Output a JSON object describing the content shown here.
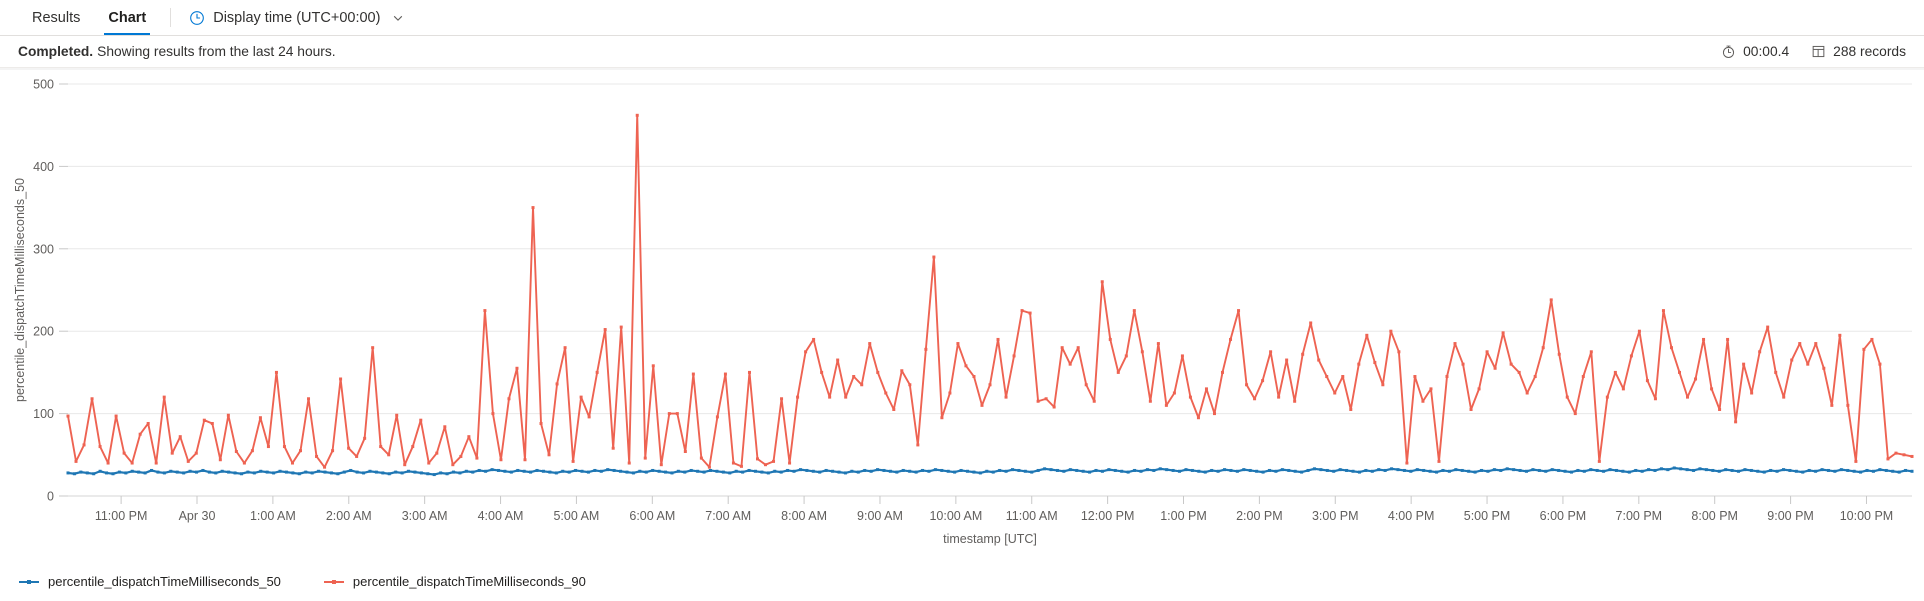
{
  "tabs": [
    {
      "label": "Results",
      "active": false,
      "name": "tab-results"
    },
    {
      "label": "Chart",
      "active": true,
      "name": "tab-chart"
    }
  ],
  "toolbar": {
    "display_time_label": "Display time (UTC+00:00)",
    "clock_icon": "clock-icon",
    "chevron_icon": "chevron-down-icon"
  },
  "status": {
    "state": "Completed.",
    "message": "Showing results from the last 24 hours.",
    "duration": "00:00.4",
    "duration_icon": "stopwatch-icon",
    "records": "288 records",
    "records_icon": "table-icon"
  },
  "colors": {
    "accent": "#0078d4",
    "series_50": "#1f77b4",
    "series_90": "#ee6352",
    "gridline": "#e8e8e8",
    "text": "#323130",
    "muted": "#605e5c"
  },
  "chart_data": {
    "type": "line",
    "title": "",
    "xlabel": "timestamp [UTC]",
    "ylabel": "percentile_dispatchTimeMilliseconds_50",
    "ylim": [
      0,
      500
    ],
    "yticks": [
      0,
      100,
      200,
      300,
      400,
      500
    ],
    "grid": true,
    "legend_position": "bottom-left",
    "xticks": [
      "11:00 PM",
      "Apr 30",
      "1:00 AM",
      "2:00 AM",
      "3:00 AM",
      "4:00 AM",
      "5:00 AM",
      "6:00 AM",
      "7:00 AM",
      "8:00 AM",
      "9:00 AM",
      "10:00 AM",
      "11:00 AM",
      "12:00 PM",
      "1:00 PM",
      "2:00 PM",
      "3:00 PM",
      "4:00 PM",
      "5:00 PM",
      "6:00 PM",
      "7:00 PM",
      "8:00 PM",
      "9:00 PM",
      "10:00 PM"
    ],
    "x_start_hours": 22.3,
    "x_end_hours": 46.6,
    "series": [
      {
        "name": "percentile_dispatchTimeMilliseconds_50",
        "color": "#1f77b4",
        "values": [
          28,
          27,
          29,
          28,
          27,
          30,
          28,
          27,
          29,
          28,
          30,
          29,
          28,
          31,
          29,
          28,
          30,
          29,
          28,
          30,
          29,
          31,
          29,
          28,
          30,
          29,
          28,
          27,
          29,
          28,
          30,
          29,
          28,
          30,
          29,
          28,
          27,
          29,
          28,
          30,
          29,
          28,
          27,
          29,
          31,
          29,
          28,
          30,
          29,
          28,
          27,
          29,
          28,
          30,
          29,
          28,
          27,
          26,
          28,
          27,
          29,
          28,
          30,
          29,
          31,
          30,
          32,
          31,
          30,
          29,
          31,
          30,
          29,
          31,
          30,
          29,
          28,
          30,
          29,
          31,
          30,
          29,
          31,
          30,
          32,
          31,
          30,
          29,
          28,
          30,
          29,
          31,
          30,
          29,
          28,
          30,
          29,
          31,
          30,
          29,
          31,
          30,
          29,
          28,
          30,
          29,
          31,
          30,
          29,
          28,
          30,
          29,
          31,
          30,
          32,
          31,
          30,
          29,
          31,
          30,
          29,
          28,
          30,
          29,
          31,
          30,
          32,
          31,
          30,
          29,
          31,
          30,
          29,
          31,
          30,
          32,
          31,
          30,
          29,
          31,
          30,
          29,
          28,
          30,
          29,
          31,
          30,
          32,
          31,
          30,
          29,
          31,
          33,
          32,
          31,
          30,
          32,
          31,
          30,
          29,
          31,
          30,
          32,
          31,
          30,
          29,
          31,
          30,
          32,
          31,
          33,
          32,
          31,
          30,
          32,
          31,
          30,
          29,
          31,
          30,
          32,
          31,
          30,
          32,
          31,
          30,
          29,
          31,
          30,
          32,
          31,
          30,
          29,
          31,
          33,
          32,
          31,
          30,
          32,
          31,
          30,
          29,
          31,
          30,
          32,
          31,
          33,
          32,
          31,
          30,
          32,
          31,
          30,
          29,
          31,
          30,
          32,
          31,
          30,
          29,
          31,
          30,
          32,
          31,
          33,
          32,
          31,
          30,
          32,
          31,
          30,
          32,
          31,
          30,
          29,
          31,
          30,
          32,
          31,
          30,
          32,
          31,
          30,
          29,
          31,
          30,
          32,
          31,
          33,
          32,
          34,
          33,
          32,
          31,
          33,
          32,
          31,
          30,
          32,
          31,
          30,
          32,
          31,
          30,
          29,
          31,
          30,
          32,
          31,
          30,
          29,
          31,
          30,
          32,
          31,
          30,
          32,
          31,
          30,
          29,
          31,
          30,
          32,
          31,
          30,
          29,
          31,
          30
        ]
      },
      {
        "name": "percentile_dispatchTimeMilliseconds_90",
        "color": "#ee6352",
        "values": [
          97,
          42,
          62,
          118,
          60,
          40,
          97,
          52,
          40,
          75,
          88,
          40,
          120,
          52,
          72,
          42,
          52,
          92,
          88,
          44,
          98,
          54,
          40,
          55,
          95,
          60,
          150,
          60,
          40,
          55,
          118,
          48,
          35,
          55,
          142,
          58,
          48,
          70,
          180,
          60,
          50,
          98,
          38,
          60,
          92,
          40,
          52,
          84,
          38,
          48,
          72,
          46,
          225,
          100,
          44,
          118,
          155,
          44,
          350,
          88,
          50,
          136,
          180,
          42,
          120,
          96,
          150,
          202,
          58,
          205,
          40,
          462,
          46,
          158,
          38,
          100,
          100,
          54,
          148,
          46,
          35,
          96,
          148,
          40,
          36,
          150,
          45,
          38,
          42,
          118,
          40,
          120,
          175,
          190,
          150,
          120,
          165,
          120,
          145,
          135,
          185,
          150,
          125,
          105,
          152,
          135,
          62,
          178,
          290,
          95,
          125,
          185,
          158,
          145,
          110,
          135,
          190,
          120,
          170,
          225,
          222,
          115,
          118,
          108,
          180,
          160,
          180,
          135,
          115,
          260,
          190,
          150,
          170,
          225,
          175,
          115,
          185,
          110,
          125,
          170,
          120,
          95,
          130,
          100,
          150,
          190,
          225,
          135,
          118,
          140,
          175,
          120,
          165,
          115,
          172,
          210,
          165,
          145,
          125,
          145,
          105,
          160,
          195,
          162,
          135,
          200,
          175,
          40,
          145,
          115,
          130,
          42,
          145,
          185,
          160,
          105,
          130,
          175,
          155,
          198,
          160,
          150,
          125,
          145,
          180,
          238,
          172,
          120,
          100,
          145,
          175,
          42,
          120,
          150,
          130,
          170,
          200,
          140,
          118,
          225,
          180,
          150,
          120,
          142,
          190,
          130,
          105,
          190,
          90,
          160,
          125,
          175,
          205,
          150,
          120,
          165,
          185,
          160,
          185,
          155,
          110,
          195,
          110,
          42,
          178,
          190,
          160,
          45,
          52,
          50,
          48
        ]
      }
    ]
  },
  "legend": [
    {
      "label": "percentile_dispatchTimeMilliseconds_50",
      "color": "#1f77b4"
    },
    {
      "label": "percentile_dispatchTimeMilliseconds_90",
      "color": "#ee6352"
    }
  ]
}
